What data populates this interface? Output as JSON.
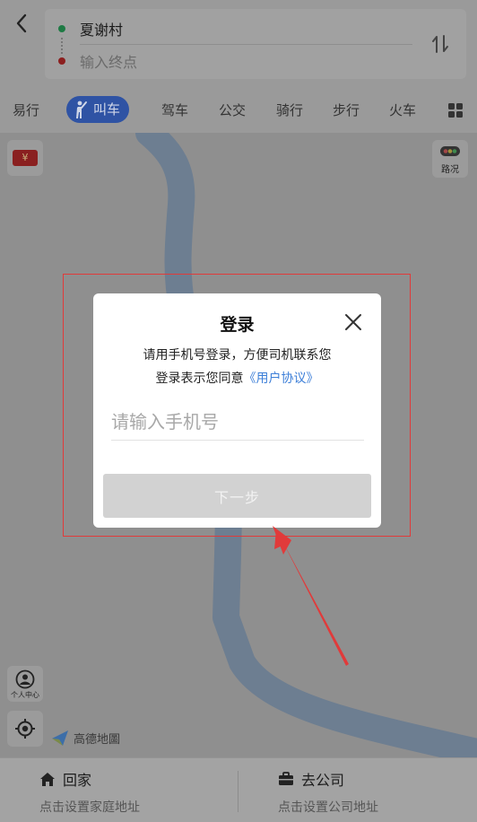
{
  "route": {
    "start": "夏谢村",
    "end_placeholder": "输入终点"
  },
  "modes": [
    {
      "label": "易行",
      "active": false
    },
    {
      "label": "叫车",
      "active": true
    },
    {
      "label": "驾车",
      "active": false
    },
    {
      "label": "公交",
      "active": false
    },
    {
      "label": "骑行",
      "active": false
    },
    {
      "label": "步行",
      "active": false
    },
    {
      "label": "火车",
      "active": false
    }
  ],
  "map": {
    "coupon_symbol": "¥",
    "traffic_label": "路况",
    "profile_label": "个人中心",
    "logo_text": "高德地圖"
  },
  "bottom": {
    "home": {
      "title": "回家",
      "hint": "点击设置家庭地址"
    },
    "company": {
      "title": "去公司",
      "hint": "点击设置公司地址"
    }
  },
  "dialog": {
    "title": "登录",
    "description": "请用手机号登录，方便司机联系您",
    "agree_prefix": "登录表示您同意",
    "agreement_link": "《用户协议》",
    "phone_placeholder": "请输入手机号",
    "next_label": "下一步"
  },
  "icons": {
    "back": "back-chevron-icon",
    "swap": "swap-arrows-icon",
    "taxi": "hail-person-icon",
    "more": "grid-icon",
    "close": "close-icon",
    "home": "home-icon",
    "company": "briefcase-icon",
    "locate": "crosshair-icon",
    "profile": "user-icon",
    "traffic": "traffic-light-icon"
  },
  "colors": {
    "overlay_bg": "#8f8f8f",
    "active_tab": "#2f53a4",
    "start_dot": "#1e7a44",
    "end_dot": "#8c1f1f",
    "link": "#3d7fd8",
    "annotation": "#e13a3a",
    "road": "#6d7e91"
  }
}
